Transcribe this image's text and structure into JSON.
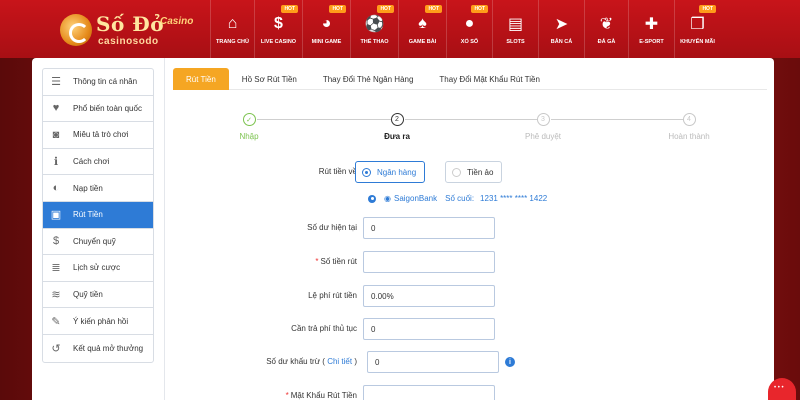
{
  "brand": {
    "name": "Số Đỏ",
    "casino": "Casino",
    "sub": "casinosodo"
  },
  "nav": [
    {
      "label": "Trang chủ",
      "icon": "home-icon",
      "glyph": "⌂",
      "hot": false,
      "w": 44
    },
    {
      "label": "Live Casino",
      "icon": "casino-chip-icon",
      "glyph": "$",
      "hot": true,
      "w": 48
    },
    {
      "label": "Mini Game",
      "icon": "gamepad-icon",
      "glyph": "◕",
      "hot": true,
      "w": 48
    },
    {
      "label": "Thể Thao",
      "icon": "soccer-ball-icon",
      "glyph": "⚽",
      "hot": true,
      "w": 48
    },
    {
      "label": "Game Bài",
      "icon": "playing-cards-icon",
      "glyph": "♠",
      "hot": true,
      "w": 48
    },
    {
      "label": "Xổ Số",
      "icon": "lottery-ball-icon",
      "glyph": "●",
      "hot": true,
      "w": 46
    },
    {
      "label": "Slots",
      "icon": "slot-machine-icon",
      "glyph": "▤",
      "hot": false,
      "w": 46
    },
    {
      "label": "Bắn Cá",
      "icon": "fish-icon",
      "glyph": "➤",
      "hot": false,
      "w": 46
    },
    {
      "label": "Đá Gà",
      "icon": "rooster-icon",
      "glyph": "❦",
      "hot": false,
      "w": 44
    },
    {
      "label": "E-Sport",
      "icon": "controller-icon",
      "glyph": "✚",
      "hot": false,
      "w": 46
    },
    {
      "label": "Khuyến Mãi",
      "icon": "gift-icon",
      "glyph": "❒",
      "hot": true,
      "w": 46
    }
  ],
  "hot_label": "HOT",
  "sidebar": [
    {
      "label": "Thông tin cá nhân",
      "icon": "user-card-icon",
      "glyph": "☰",
      "active": false
    },
    {
      "label": "Phổ biến toàn quốc",
      "icon": "heart-icon",
      "glyph": "♥",
      "active": false
    },
    {
      "label": "Miêu tả trò chơi",
      "icon": "gamepad-icon",
      "glyph": "◙",
      "active": false
    },
    {
      "label": "Cách chơi",
      "icon": "info-icon",
      "glyph": "ℹ",
      "active": false
    },
    {
      "label": "Nạp tiền",
      "icon": "piggy-bank-icon",
      "glyph": "◐",
      "active": false
    },
    {
      "label": "Rút Tiền",
      "icon": "withdraw-icon",
      "glyph": "▣",
      "active": true
    },
    {
      "label": "Chuyển quỹ",
      "icon": "dollar-circle-icon",
      "glyph": "$",
      "active": false
    },
    {
      "label": "Lịch sử cược",
      "icon": "history-list-icon",
      "glyph": "≣",
      "active": false
    },
    {
      "label": "Quỹ tiền",
      "icon": "money-stack-icon",
      "glyph": "≋",
      "active": false
    },
    {
      "label": "Ý kiến phản hồi",
      "icon": "edit-feedback-icon",
      "glyph": "✎",
      "active": false
    },
    {
      "label": "Kết quả mở thưởng",
      "icon": "history-clock-icon",
      "glyph": "↺",
      "active": false
    }
  ],
  "tabs": [
    {
      "label": "Rút Tiền",
      "active": true
    },
    {
      "label": "Hồ Sơ Rút Tiền",
      "active": false
    },
    {
      "label": "Thay Đổi Thẻ Ngân Hàng",
      "active": false
    },
    {
      "label": "Thay Đổi Mật Khẩu Rút Tiền",
      "active": false
    }
  ],
  "steps": [
    {
      "num": "✓",
      "label": "Nhập",
      "state": "done"
    },
    {
      "num": "2",
      "label": "Đưa ra",
      "state": "current"
    },
    {
      "num": "3",
      "label": "Phê duyệt",
      "state": "pending"
    },
    {
      "num": "4",
      "label": "Hoàn thành",
      "state": "pending"
    }
  ],
  "form": {
    "withdraw_to_label": "Rút tiền về",
    "option_bank": "Ngân hàng",
    "option_virtual": "Tiền ảo",
    "bank_name": "SaigonBank",
    "bank_last_label": "Số cuối:",
    "bank_number": "1231 **** **** 1422",
    "balance_label": "Số dư hiện tại",
    "balance_value": "0",
    "amount_label": "Số tiền rút",
    "amount_value": "",
    "fee_label": "Lệ phí rút tiền",
    "fee_value": "0.00%",
    "need_fee_label": "Cần trả phí thủ tục",
    "need_fee_value": "0",
    "deduct_label": "Số dư khấu trừ (",
    "deduct_link": "Chi tiết",
    "deduct_close": ")",
    "deduct_value": "0",
    "password_label": "Mật Khẩu Rút Tiền",
    "password_value": ""
  },
  "colors": {
    "accent": "#2e7bd6",
    "tab_active": "#f5a623",
    "header": "#c8141a",
    "step_done": "#7cc34f"
  }
}
